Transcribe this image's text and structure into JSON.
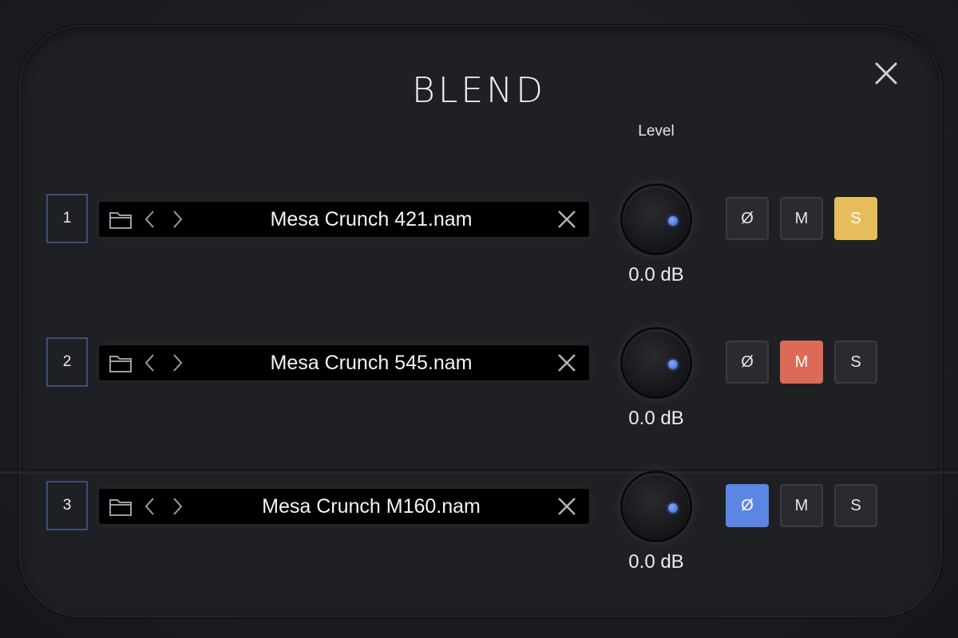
{
  "title": "BLEND",
  "level_header": "Level",
  "colors": {
    "solo_active": "#e5bd5c",
    "mute_active": "#dd6a57",
    "phase_active": "#5b86e5",
    "inactive": "#2a2b30"
  },
  "icons": {
    "close": "close-icon",
    "folder": "folder-icon",
    "prev": "chevron-left-icon",
    "next": "chevron-right-icon",
    "clear": "clear-icon",
    "knob_indicator": "knob-indicator-dot"
  },
  "slots": [
    {
      "number": "1",
      "file_name": "Mesa Crunch 421.nam",
      "level": "0.0 dB",
      "phase_label": "Ø",
      "mute_label": "M",
      "solo_label": "S",
      "phase_active": false,
      "mute_active": false,
      "solo_active": true
    },
    {
      "number": "2",
      "file_name": "Mesa Crunch 545.nam",
      "level": "0.0 dB",
      "phase_label": "Ø",
      "mute_label": "M",
      "solo_label": "S",
      "phase_active": false,
      "mute_active": true,
      "solo_active": false
    },
    {
      "number": "3",
      "file_name": "Mesa Crunch M160.nam",
      "level": "0.0 dB",
      "phase_label": "Ø",
      "mute_label": "M",
      "solo_label": "S",
      "phase_active": true,
      "mute_active": false,
      "solo_active": false
    }
  ]
}
